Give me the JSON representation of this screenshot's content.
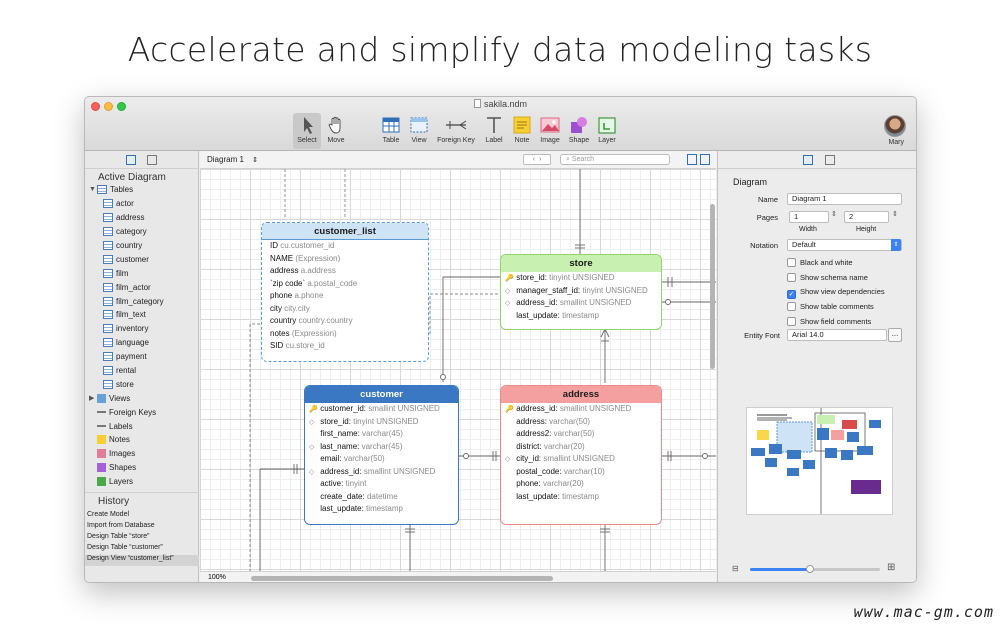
{
  "headline": "Accelerate and simplify data modeling tasks",
  "watermark": "www.mac-gm.com",
  "window": {
    "title": "sakila.ndm"
  },
  "toolbar": {
    "tools": [
      {
        "label": "Select",
        "icon": "arrow-cursor-icon"
      },
      {
        "label": "Move",
        "icon": "hand-icon"
      },
      {
        "label": "Table",
        "icon": "table-icon"
      },
      {
        "label": "View",
        "icon": "view-icon"
      },
      {
        "label": "Foreign Key",
        "icon": "foreign-key-icon"
      },
      {
        "label": "Label",
        "icon": "label-icon"
      },
      {
        "label": "Note",
        "icon": "note-icon"
      },
      {
        "label": "Image",
        "icon": "image-icon"
      },
      {
        "label": "Shape",
        "icon": "shape-icon"
      },
      {
        "label": "Layer",
        "icon": "layer-icon"
      }
    ],
    "user": "Mary"
  },
  "sidebar": {
    "section": "Active Diagram",
    "tables_label": "Tables",
    "tables": [
      "actor",
      "address",
      "category",
      "country",
      "customer",
      "film",
      "film_actor",
      "film_category",
      "film_text",
      "inventory",
      "language",
      "payment",
      "rental",
      "store"
    ],
    "groups": [
      "Views",
      "Foreign Keys",
      "Labels",
      "Notes",
      "Images",
      "Shapes",
      "Layers"
    ],
    "history_title": "History",
    "history": [
      "Create Model",
      "Import from Database",
      "Design Table “store”",
      "Design Table “customer”",
      "Design View “customer_list”"
    ]
  },
  "canvas": {
    "diagram_select": "Diagram 1",
    "search_placeholder": "Search",
    "zoom": "100%"
  },
  "entities": {
    "customer_list": {
      "title": "customer_list",
      "rows": [
        {
          "name": "ID",
          "type": "cu.customer_id"
        },
        {
          "name": "NAME",
          "type": "(Expression)"
        },
        {
          "name": "address",
          "type": "a.address"
        },
        {
          "name": "`zip code`",
          "type": "a.postal_code"
        },
        {
          "name": "phone",
          "type": "a.phone"
        },
        {
          "name": "city",
          "type": "city.city"
        },
        {
          "name": "country",
          "type": "country.country"
        },
        {
          "name": "notes",
          "type": "(Expression)"
        },
        {
          "name": "SID",
          "type": "cu.store_id"
        }
      ]
    },
    "store": {
      "title": "store",
      "rows": [
        {
          "name": "store_id:",
          "type": "tinyint UNSIGNED"
        },
        {
          "name": "manager_staff_id:",
          "type": "tinyint UNSIGNED"
        },
        {
          "name": "address_id:",
          "type": "smallint UNSIGNED"
        },
        {
          "name": "last_update:",
          "type": "timestamp"
        }
      ]
    },
    "customer": {
      "title": "customer",
      "rows": [
        {
          "name": "customer_id:",
          "type": "smallint UNSIGNED"
        },
        {
          "name": "store_id:",
          "type": "tinyint UNSIGNED"
        },
        {
          "name": "first_name:",
          "type": "varchar(45)"
        },
        {
          "name": "last_name:",
          "type": "varchar(45)"
        },
        {
          "name": "email:",
          "type": "varchar(50)"
        },
        {
          "name": "address_id:",
          "type": "smallint UNSIGNED"
        },
        {
          "name": "active:",
          "type": "tinyint"
        },
        {
          "name": "create_date:",
          "type": "datetime"
        },
        {
          "name": "last_update:",
          "type": "timestamp"
        }
      ]
    },
    "address": {
      "title": "address",
      "rows": [
        {
          "name": "address_id:",
          "type": "smallint UNSIGNED"
        },
        {
          "name": "address:",
          "type": "varchar(50)"
        },
        {
          "name": "address2:",
          "type": "varchar(50)"
        },
        {
          "name": "district:",
          "type": "varchar(20)"
        },
        {
          "name": "city_id:",
          "type": "smallint UNSIGNED"
        },
        {
          "name": "postal_code:",
          "type": "varchar(10)"
        },
        {
          "name": "phone:",
          "type": "varchar(20)"
        },
        {
          "name": "last_update:",
          "type": "timestamp"
        }
      ]
    }
  },
  "inspector": {
    "title": "Diagram",
    "name_label": "Name",
    "name_value": "Diagram 1",
    "pages_label": "Pages",
    "pages_width": "1",
    "pages_height": "2",
    "width_label": "Width",
    "height_label": "Height",
    "notation_label": "Notation",
    "notation_value": "Default",
    "options": [
      {
        "label": "Black and white",
        "checked": false
      },
      {
        "label": "Show schema name",
        "checked": false
      },
      {
        "label": "Show view dependencies",
        "checked": true
      },
      {
        "label": "Show table comments",
        "checked": false
      },
      {
        "label": "Show field comments",
        "checked": false
      }
    ],
    "font_label": "Entity Font",
    "font_value": "Arial  14.0",
    "font_button": "..."
  },
  "colors": {
    "customer_list_header": "#cfe3f7",
    "store_header": "#c8f0b0",
    "customer_header": "#3a78c4",
    "address_header": "#f5a0a0"
  }
}
